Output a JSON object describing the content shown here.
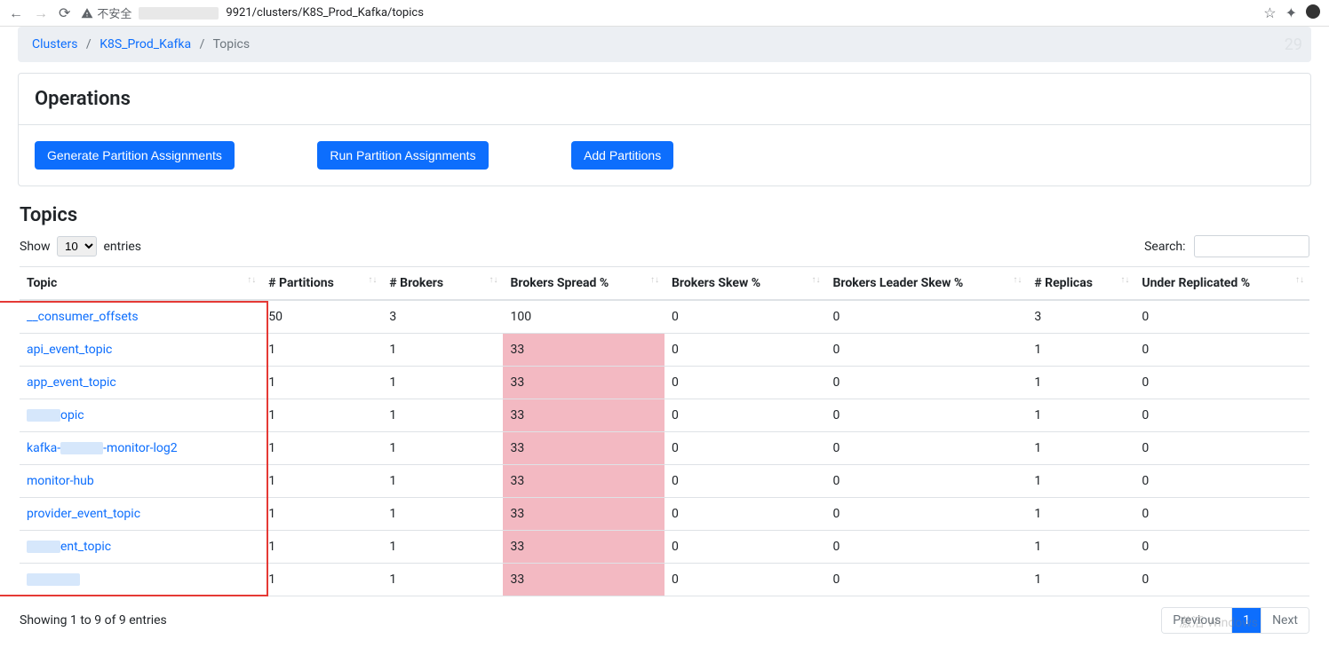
{
  "browser": {
    "security_label": "不安全",
    "url_host_suffix": "9921/clusters/K8S_Prod_Kafka/topics"
  },
  "breadcrumb": {
    "items": [
      {
        "label": "Clusters",
        "link": true
      },
      {
        "label": "K8S_Prod_Kafka",
        "link": true
      },
      {
        "label": "Topics",
        "link": false
      }
    ],
    "faded_count": "29"
  },
  "operations": {
    "title": "Operations",
    "buttons": {
      "generate": "Generate Partition Assignments",
      "run": "Run Partition Assignments",
      "add": "Add Partitions"
    }
  },
  "topics": {
    "title": "Topics",
    "show_label": "Show",
    "entries_label": "entries",
    "page_size": "10",
    "search_label": "Search:",
    "columns": [
      "Topic",
      "# Partitions",
      "# Brokers",
      "Brokers Spread %",
      "Brokers Skew %",
      "Brokers Leader Skew %",
      "# Replicas",
      "Under Replicated %"
    ],
    "rows": [
      {
        "topic": "__consumer_offsets",
        "blur": false,
        "partitions": "50",
        "brokers": "3",
        "spread": "100",
        "spread_hi": false,
        "skew": "0",
        "leader_skew": "0",
        "replicas": "3",
        "under": "0"
      },
      {
        "topic": "api_event_topic",
        "blur": false,
        "partitions": "1",
        "brokers": "1",
        "spread": "33",
        "spread_hi": true,
        "skew": "0",
        "leader_skew": "0",
        "replicas": "1",
        "under": "0"
      },
      {
        "topic": "app_event_topic",
        "blur": false,
        "partitions": "1",
        "brokers": "1",
        "spread": "33",
        "spread_hi": true,
        "skew": "0",
        "leader_skew": "0",
        "replicas": "1",
        "under": "0"
      },
      {
        "topic": "opic",
        "blur": "prefix",
        "partitions": "1",
        "brokers": "1",
        "spread": "33",
        "spread_hi": true,
        "skew": "0",
        "leader_skew": "0",
        "replicas": "1",
        "under": "0"
      },
      {
        "topic": "kafka-",
        "topic_suffix": "-monitor-log2",
        "blur": "middle",
        "partitions": "1",
        "brokers": "1",
        "spread": "33",
        "spread_hi": true,
        "skew": "0",
        "leader_skew": "0",
        "replicas": "1",
        "under": "0"
      },
      {
        "topic": "monitor-hub",
        "blur": false,
        "partitions": "1",
        "brokers": "1",
        "spread": "33",
        "spread_hi": true,
        "skew": "0",
        "leader_skew": "0",
        "replicas": "1",
        "under": "0"
      },
      {
        "topic": "provider_event_topic",
        "blur": false,
        "partitions": "1",
        "brokers": "1",
        "spread": "33",
        "spread_hi": true,
        "skew": "0",
        "leader_skew": "0",
        "replicas": "1",
        "under": "0"
      },
      {
        "topic": "ent_topic",
        "blur": "prefix",
        "partitions": "1",
        "brokers": "1",
        "spread": "33",
        "spread_hi": true,
        "skew": "0",
        "leader_skew": "0",
        "replicas": "1",
        "under": "0"
      },
      {
        "topic": "",
        "blur": "full",
        "partitions": "1",
        "brokers": "1",
        "spread": "33",
        "spread_hi": true,
        "skew": "0",
        "leader_skew": "0",
        "replicas": "1",
        "under": "0"
      }
    ],
    "info": "Showing 1 to 9 of 9 entries",
    "pagination": {
      "previous": "Previous",
      "current": "1",
      "next": "Next"
    }
  },
  "watermark": "激活 Windows"
}
